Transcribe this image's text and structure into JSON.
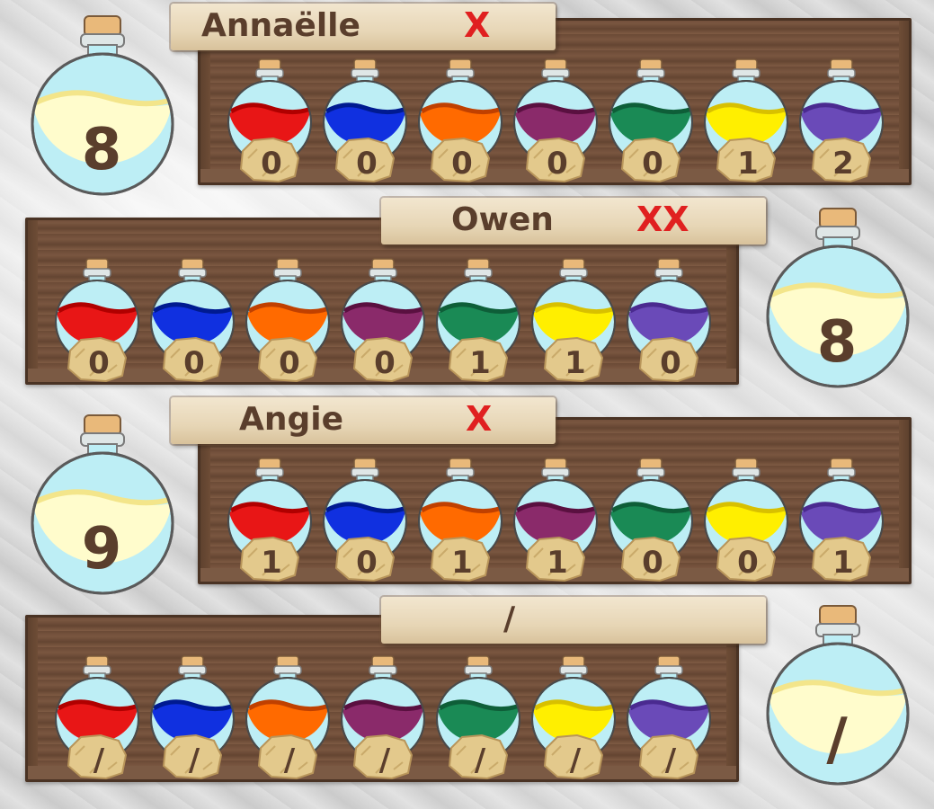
{
  "colors": {
    "potions": [
      "#e81616",
      "#1030e0",
      "#ff6a00",
      "#8a2a6a",
      "#1a8a55",
      "#ffef00",
      "#6a4ab8"
    ],
    "potions_dark": [
      "#b00000",
      "#001a90",
      "#c04000",
      "#5a1040",
      "#0e5e38",
      "#d8c000",
      "#4a2a90"
    ],
    "bottle_glass": "#bdeef5",
    "cork": "#e9b97a",
    "stone": "#e3c98c",
    "score_fill": "#fffccc",
    "name_text": "#5a3e2c",
    "mark_text": "#e02020"
  },
  "players": [
    {
      "name": "Annaëlle",
      "marks": "X",
      "score": "8",
      "values": [
        "0",
        "0",
        "0",
        "0",
        "0",
        "1",
        "2"
      ]
    },
    {
      "name": "Owen",
      "marks": "XX",
      "score": "8",
      "values": [
        "0",
        "0",
        "0",
        "0",
        "1",
        "1",
        "0"
      ]
    },
    {
      "name": "Angie",
      "marks": "X",
      "score": "9",
      "values": [
        "1",
        "0",
        "1",
        "1",
        "0",
        "0",
        "1"
      ]
    },
    {
      "name": "/",
      "marks": "",
      "score": "/",
      "values": [
        "/",
        "/",
        "/",
        "/",
        "/",
        "/",
        "/"
      ]
    }
  ]
}
